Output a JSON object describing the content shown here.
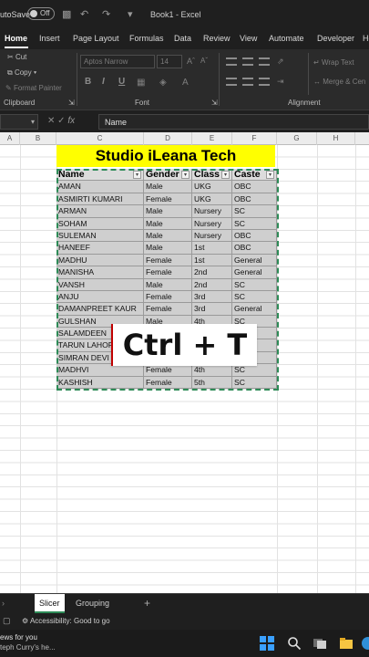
{
  "titlebar": {
    "autosave": "utoSave",
    "toggle": "Off",
    "title": "Book1 - Excel"
  },
  "tabs": [
    "Home",
    "Insert",
    "Page Layout",
    "Formulas",
    "Data",
    "Review",
    "View",
    "Automate",
    "Developer",
    "He"
  ],
  "ribbon": {
    "cut": "Cut",
    "copy": "Copy",
    "format_painter": "Format Painter",
    "clipboard": "Clipboard",
    "font_name": "Aptos Narrow",
    "font_size": "14",
    "font_group": "Font",
    "wrap_text": "Wrap Text",
    "merge_center": "Merge & Cen",
    "alignment_group": "Alignment",
    "bold": "B",
    "italic": "I",
    "underline": "U"
  },
  "formula_bar": {
    "fx": "fx",
    "value": "Name"
  },
  "columns": [
    "A",
    "B",
    "C",
    "D",
    "E",
    "F",
    "G",
    "H"
  ],
  "banner": "Studio iLeana Tech",
  "table": {
    "headers": [
      "Name",
      "Gender",
      "Class",
      "Caste"
    ],
    "rows": [
      [
        "AMAN",
        "Male",
        "UKG",
        "OBC"
      ],
      [
        "ASMIRTI KUMARI",
        "Female",
        "UKG",
        "OBC"
      ],
      [
        "ARMAN",
        "Male",
        "Nursery",
        "SC"
      ],
      [
        "SOHAM",
        "Male",
        "Nursery",
        "SC"
      ],
      [
        "SULEMAN",
        "Male",
        "Nursery",
        "OBC"
      ],
      [
        "HANEEF",
        "Male",
        "1st",
        "OBC"
      ],
      [
        "MADHU",
        "Female",
        "1st",
        "General"
      ],
      [
        "MANISHA",
        "Female",
        "2nd",
        "General"
      ],
      [
        "VANSH",
        "Male",
        "2nd",
        "SC"
      ],
      [
        "ANJU",
        "Female",
        "3rd",
        "SC"
      ],
      [
        "DAMANPREET KAUR",
        "Female",
        "3rd",
        "General"
      ],
      [
        "GULSHAN",
        "Male",
        "4th",
        "SC"
      ],
      [
        "SALAMDEEN",
        "",
        "",
        ""
      ],
      [
        "TARUN LAHOR",
        "",
        "",
        ""
      ],
      [
        "SIMRAN DEVI",
        "",
        "",
        ""
      ],
      [
        "MADHVI",
        "Female",
        "4th",
        "SC"
      ],
      [
        "KASHISH",
        "Female",
        "5th",
        "SC"
      ]
    ]
  },
  "shortcut": "Ctrl + T",
  "sheets": [
    "Slicer",
    "Grouping"
  ],
  "status": {
    "accessibility": "Accessibility: Good to go"
  },
  "taskbar": {
    "news_line1": "ews for you",
    "news_line2": "teph Curry's he..."
  }
}
